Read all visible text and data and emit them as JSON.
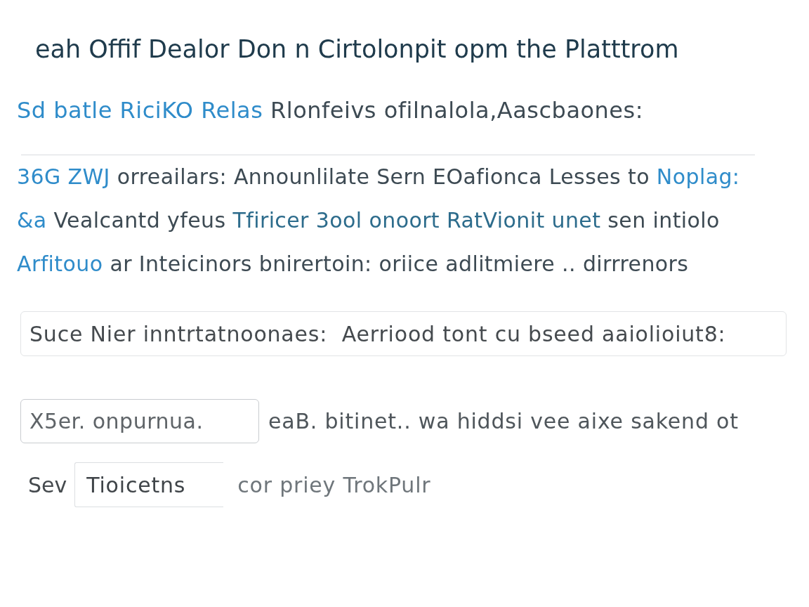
{
  "heading": "eah Offif Dealor Don n Cirtolonpit opm the Platttrom",
  "subtitle": [
    {
      "kind": "accent",
      "text": "Sd batle RiciKO Relas"
    },
    {
      "kind": "plain",
      "text": "Rlonfeivs ofilnalola,Aascbaones:"
    }
  ],
  "lines": [
    [
      {
        "kind": "accent",
        "text": "36G ZWJ"
      },
      {
        "kind": "plain",
        "text": "orreailars: Announlilate Sern EOafionca Lesses to"
      },
      {
        "kind": "accent",
        "text": "Noplag:"
      }
    ],
    [
      {
        "kind": "accent",
        "text": "&a"
      },
      {
        "kind": "plain",
        "text": "Vealcantd yfeus"
      },
      {
        "kind": "teal",
        "text": "Tfiricer 3ool onoort RatVionit unet"
      },
      {
        "kind": "plain",
        "text": "sen intiolo"
      }
    ],
    [
      {
        "kind": "accent",
        "text": "Arfitouo"
      },
      {
        "kind": "plain",
        "text": "ar Inteicinors bnirertoin: oriice adlitmiere .. dirrrenors"
      }
    ]
  ],
  "note_field": {
    "value": "Suce Nier inntrtatnoonaes:  Aerriood tont cu bseed aaiolioiut8:"
  },
  "row_1": {
    "field": {
      "placeholder": "X5er. onpurnua."
    },
    "text": "eaB. bitinet.. wa hiddsi vee aixe sakend ot"
  },
  "row_2": {
    "label": "Sev",
    "field": {
      "value": "Tioicetns"
    },
    "text": "cor priey TrokPulr"
  }
}
